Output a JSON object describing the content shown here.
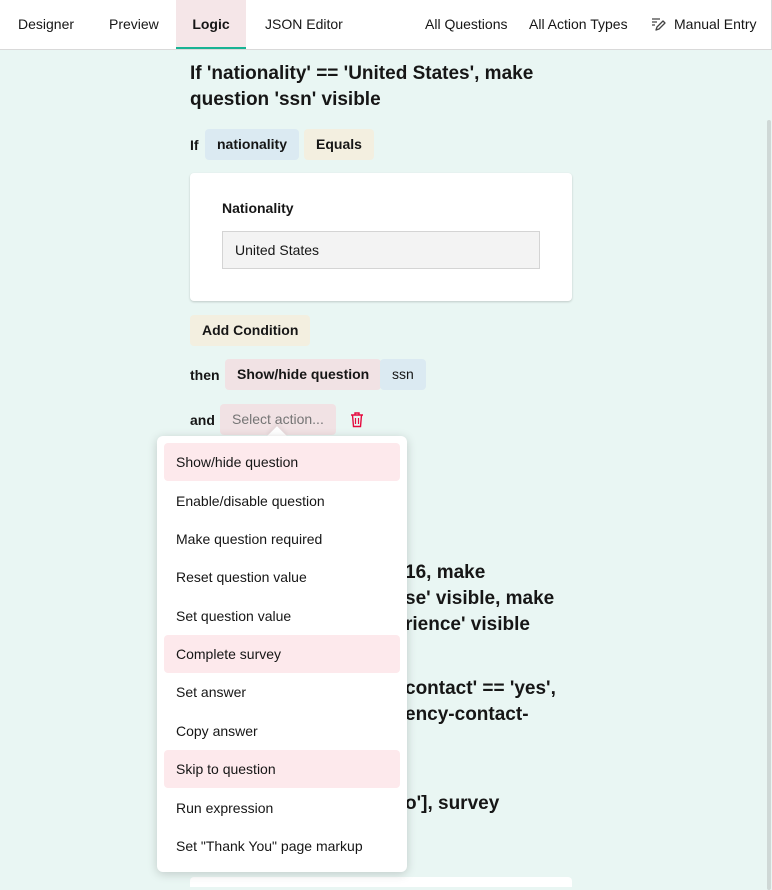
{
  "tabs": [
    {
      "label": "Designer"
    },
    {
      "label": "Preview"
    },
    {
      "label": "Logic"
    },
    {
      "label": "JSON Editor"
    }
  ],
  "toolbar": {
    "all_questions": "All Questions",
    "all_action_types": "All Action Types",
    "manual_entry": "Manual Entry"
  },
  "rule1": {
    "title_line1": "If 'nationality' == 'United States', make",
    "title_line2": "question 'ssn' visible",
    "if_label": "If",
    "question_pill": "nationality",
    "operator_pill": "Equals",
    "card_question_title": "Nationality",
    "card_question_value": "United States",
    "add_condition": "Add Condition",
    "then_label": "then",
    "action_pill": "Show/hide question",
    "target_pill": "ssn",
    "and_label": "and",
    "select_action_placeholder": "Select action..."
  },
  "background_rules": {
    "rule2_line1": "16, make",
    "rule2_line2": "se' visible, make",
    "rule2_line3": "rience' visible",
    "rule3_line1": "contact' == 'yes',",
    "rule3_line2": "ency-contact-",
    "rule4_line1": "o'], survey"
  },
  "dropdown": {
    "items": [
      {
        "label": "Show/hide question",
        "highlighted": true
      },
      {
        "label": "Enable/disable question",
        "highlighted": false
      },
      {
        "label": "Make question required",
        "highlighted": false
      },
      {
        "label": "Reset question value",
        "highlighted": false
      },
      {
        "label": "Set question value",
        "highlighted": false
      },
      {
        "label": "Complete survey",
        "highlighted": true
      },
      {
        "label": "Set answer",
        "highlighted": false
      },
      {
        "label": "Copy answer",
        "highlighted": false
      },
      {
        "label": "Skip to question",
        "highlighted": true
      },
      {
        "label": "Run expression",
        "highlighted": false
      },
      {
        "label": "Set \"Thank You\" page markup",
        "highlighted": false
      }
    ]
  },
  "colors": {
    "accent": "#19b394",
    "background": "#e9f6f3",
    "danger": "#e50a3e",
    "highlight": "#fde9ec"
  }
}
